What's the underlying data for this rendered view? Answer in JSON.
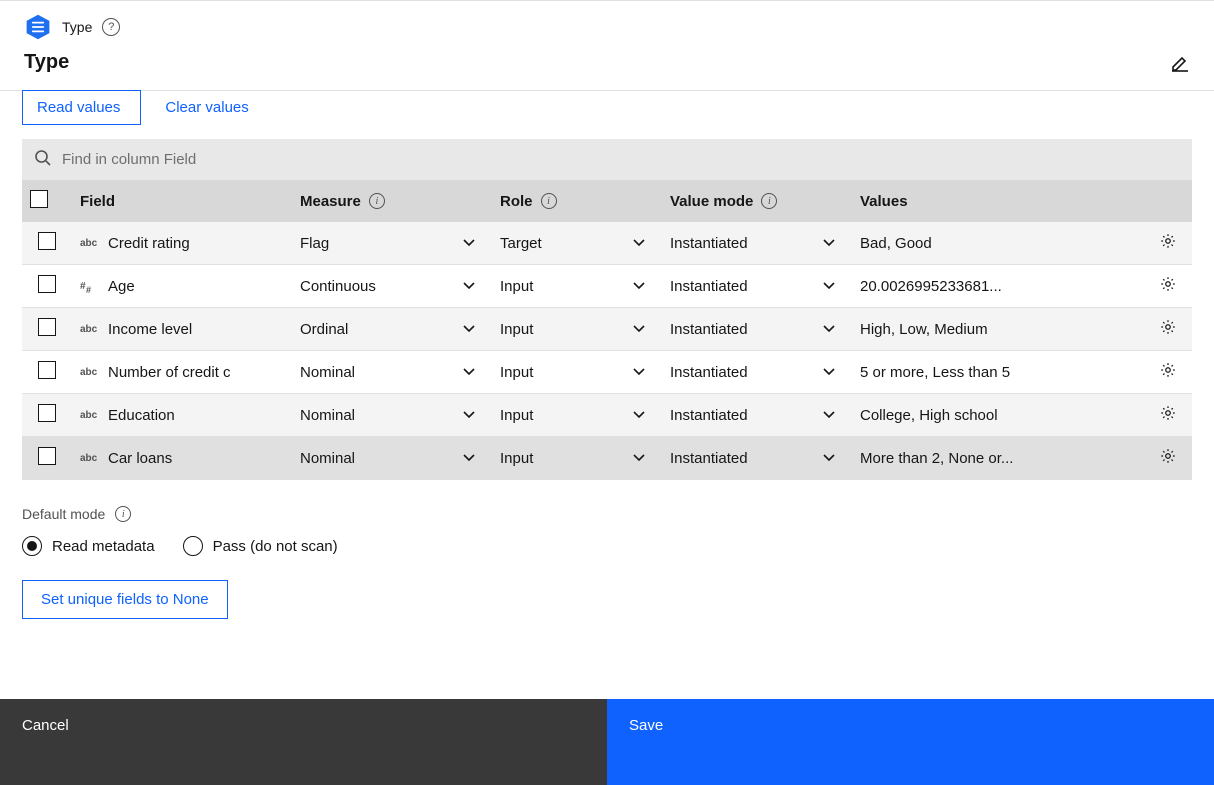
{
  "breadcrumb": {
    "label": "Type"
  },
  "title": "Type",
  "actions": {
    "read_values": "Read values",
    "clear_values": "Clear values"
  },
  "search": {
    "placeholder": "Find in column Field"
  },
  "columns": {
    "field": "Field",
    "measure": "Measure",
    "role": "Role",
    "value_mode": "Value mode",
    "values": "Values"
  },
  "rows": [
    {
      "type_icon": "abc",
      "field": "Credit rating",
      "measure": "Flag",
      "role": "Target",
      "value_mode": "Instantiated",
      "values": "Bad, Good"
    },
    {
      "type_icon": "##",
      "field": "Age",
      "measure": "Continuous",
      "role": "Input",
      "value_mode": "Instantiated",
      "values": "20.0026995233681..."
    },
    {
      "type_icon": "abc",
      "field": "Income level",
      "measure": "Ordinal",
      "role": "Input",
      "value_mode": "Instantiated",
      "values": "High, Low, Medium"
    },
    {
      "type_icon": "abc",
      "field": "Number of credit c",
      "measure": "Nominal",
      "role": "Input",
      "value_mode": "Instantiated",
      "values": "5 or more, Less than 5"
    },
    {
      "type_icon": "abc",
      "field": "Education",
      "measure": "Nominal",
      "role": "Input",
      "value_mode": "Instantiated",
      "values": "College, High school"
    },
    {
      "type_icon": "abc",
      "field": "Car loans",
      "measure": "Nominal",
      "role": "Input",
      "value_mode": "Instantiated",
      "values": "More than 2, None or..."
    }
  ],
  "default_mode": {
    "label": "Default mode",
    "options": {
      "read_metadata": "Read metadata",
      "pass": "Pass (do not scan)"
    },
    "selected": "read_metadata"
  },
  "unique_button": "Set unique fields to None",
  "footer": {
    "cancel": "Cancel",
    "save": "Save"
  }
}
